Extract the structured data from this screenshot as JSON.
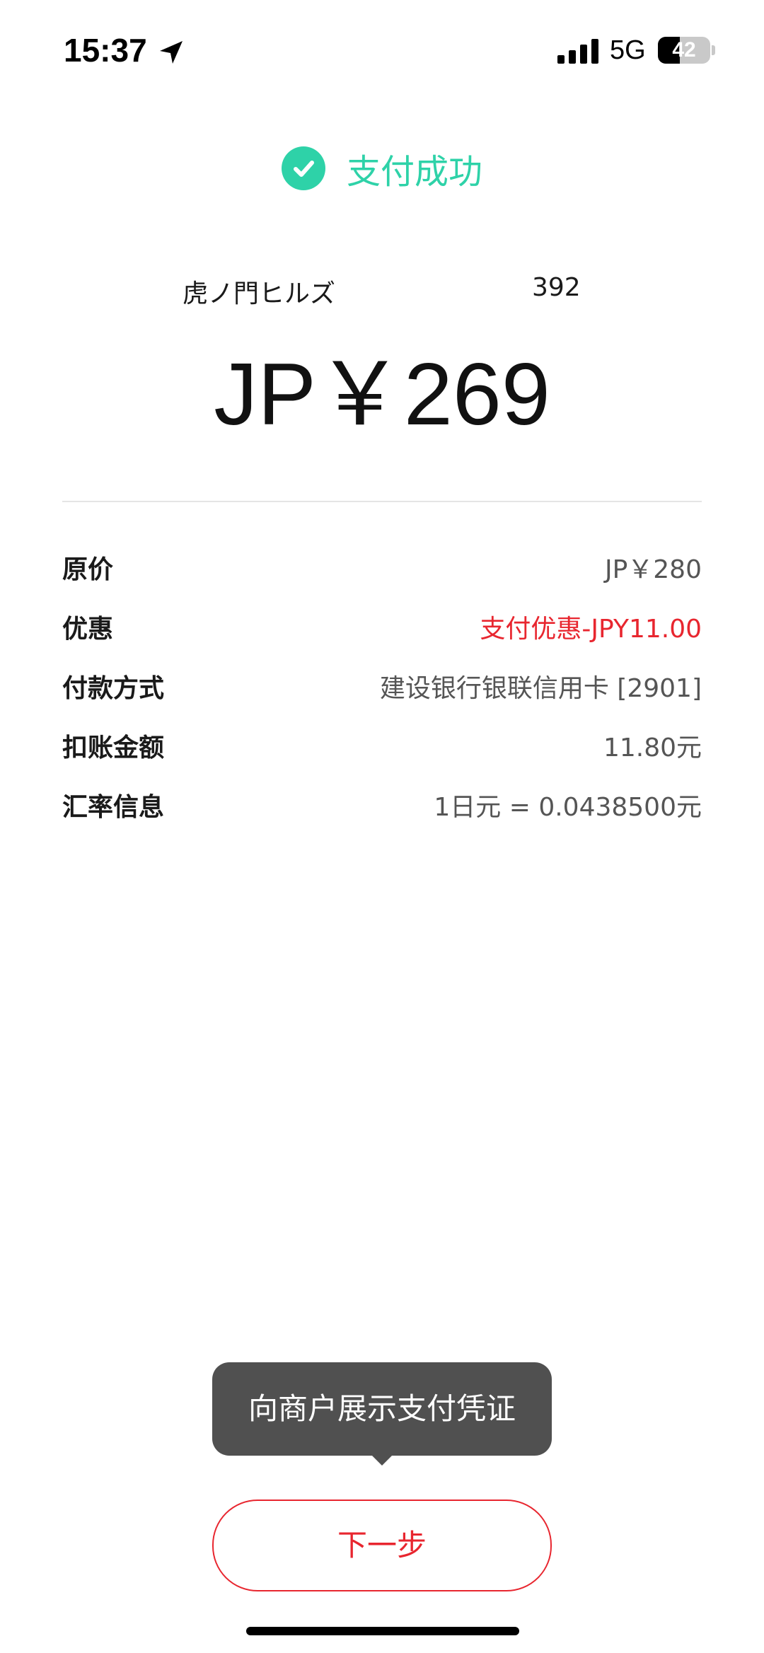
{
  "status_bar": {
    "time": "15:37",
    "network": "5G",
    "battery_level": "42",
    "battery_fraction": 0.42
  },
  "icons": {
    "location": "location-arrow-icon",
    "signal": "cellular-signal-icon",
    "battery": "battery-icon",
    "success": "check-circle-icon"
  },
  "header": {
    "status_text": "支付成功"
  },
  "merchant": {
    "name": "虎ノ門ヒルズ",
    "number": "392"
  },
  "payment": {
    "amount": "JP￥269"
  },
  "details": [
    {
      "label": "原价",
      "value": "JP￥280",
      "highlight": false
    },
    {
      "label": "优惠",
      "value": "支付优惠-JPY11.00",
      "highlight": true
    },
    {
      "label": "付款方式",
      "value": "建设银行银联信用卡 [2901]",
      "highlight": false
    },
    {
      "label": "扣账金额",
      "value": "11.80元",
      "highlight": false
    },
    {
      "label": "汇率信息",
      "value": "1日元 = 0.0438500元",
      "highlight": false
    }
  ],
  "tooltip": {
    "text": "向商户展示支付凭证"
  },
  "actions": {
    "next_label": "下一步"
  },
  "colors": {
    "success_green": "#2ed2a8",
    "accent_red": "#e8262f",
    "tooltip_bg": "#505050"
  }
}
